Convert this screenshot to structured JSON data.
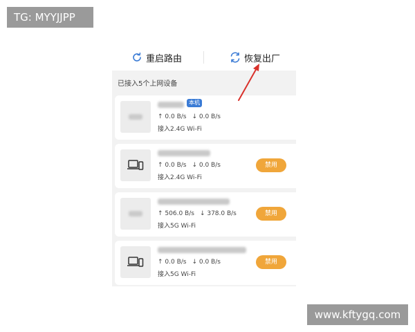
{
  "watermark_top": "TG: MYYJJPP",
  "watermark_bottom": "www.kftygq.com",
  "toolbar": {
    "reboot_label": "重启路由",
    "reset_label": "恢复出厂",
    "icon_reboot": "refresh-icon",
    "icon_reset": "reset-icon"
  },
  "section_label": "已接入5个上网设备",
  "colors": {
    "accent_blue": "#3a7bd5",
    "ban_orange": "#f0a63a",
    "arrow_red": "#d9302a"
  },
  "devices": [
    {
      "up": "↑ 0.0 B/s",
      "down": "↓ 0.0 B/s",
      "conn": "接入2.4G Wi-Fi",
      "badge": "本机",
      "icon": "blurred-thumbnail"
    },
    {
      "up": "↑ 0.0 B/s",
      "down": "↓ 0.0 B/s",
      "conn": "接入2.4G Wi-Fi",
      "ban": "禁用",
      "icon": "laptop-phone-icon"
    },
    {
      "up": "↑ 506.0 B/s",
      "down": "↓ 378.0 B/s",
      "conn": "接入5G Wi-Fi",
      "ban": "禁用",
      "icon": "blurred-thumbnail"
    },
    {
      "up": "↑ 0.0 B/s",
      "down": "↓ 0.0 B/s",
      "conn": "接入5G Wi-Fi",
      "ban": "禁用",
      "icon": "laptop-phone-icon"
    }
  ]
}
